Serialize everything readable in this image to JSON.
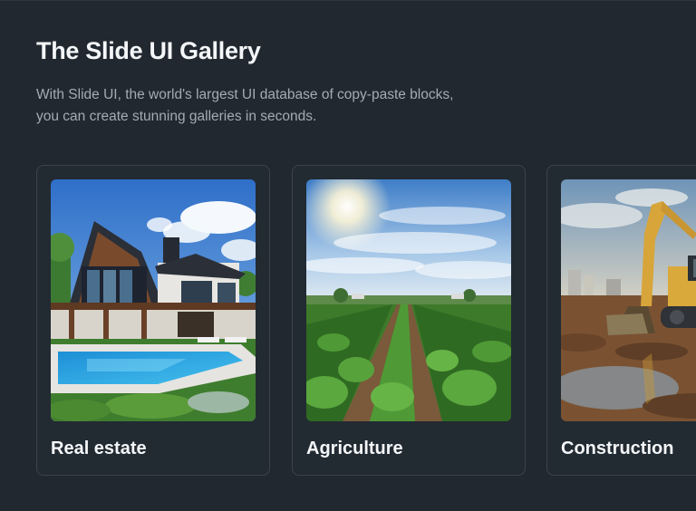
{
  "header": {
    "title": "The Slide UI Gallery",
    "subtitle_line1": "With Slide UI, the world's largest UI database of copy-paste blocks,",
    "subtitle_line2": "you can create stunning galleries in seconds."
  },
  "gallery": {
    "cards": [
      {
        "label": "Real estate",
        "image": "modern-house-with-pool-photo"
      },
      {
        "label": "Agriculture",
        "image": "crop-field-rows-photo"
      },
      {
        "label": "Construction",
        "image": "excavator-on-site-photo"
      }
    ]
  },
  "colors": {
    "background": "#212830",
    "card_border": "#3b444e",
    "title": "#f4f6f8",
    "subtitle": "#a3abb5"
  }
}
